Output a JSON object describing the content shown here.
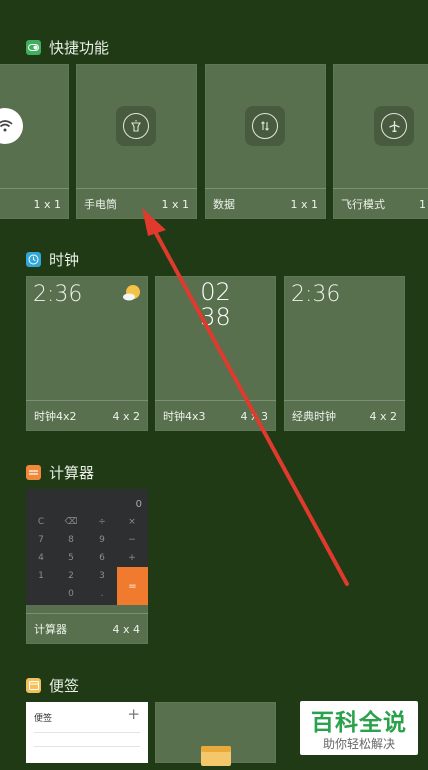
{
  "quick": {
    "title": "快捷功能",
    "tiles": [
      {
        "name": "",
        "size": "1 x 1"
      },
      {
        "name": "手电筒",
        "size": "1 x 1"
      },
      {
        "name": "数据",
        "size": "1 x 1"
      },
      {
        "name": "飞行模式",
        "size": "1"
      }
    ]
  },
  "clock": {
    "title": "时钟",
    "tiles": [
      {
        "name": "时钟4x2",
        "size": "4 x 2",
        "time": "2:36"
      },
      {
        "name": "时钟4x3",
        "size": "4 x 3",
        "hour": "02",
        "minute": "38"
      },
      {
        "name": "经典时钟",
        "size": "4 x 2",
        "time": "2:36"
      }
    ]
  },
  "calculator": {
    "title": "计算器",
    "tile": {
      "name": "计算器",
      "size": "4 x 4"
    },
    "display": "0",
    "keys": [
      "C",
      "⌫",
      "÷",
      "×",
      "7",
      "8",
      "9",
      "−",
      "4",
      "5",
      "6",
      "+",
      "1",
      "2",
      "3",
      "",
      "0",
      ".",
      "="
    ]
  },
  "notes": {
    "title": "便签",
    "tile_header": "便签",
    "add_symbol": "+"
  },
  "watermark": {
    "top": "百科全说",
    "bottom": "助你轻松解决"
  },
  "colors": {
    "accent_arrow": "#e03a2e",
    "tile_bg": "#58704d",
    "page_bg": "#1f3a14"
  }
}
